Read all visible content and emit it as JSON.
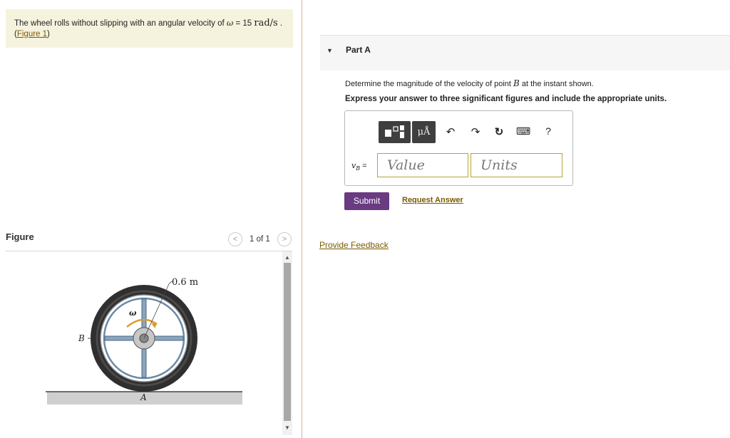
{
  "problem": {
    "text_before": "The wheel rolls without slipping with an angular velocity of ",
    "omega_symbol": "ω",
    "text_equals": " = 15 ",
    "unit": "rad/s",
    "text_after": " .",
    "figure_link": "Figure 1",
    "figure_link_open": "(",
    "figure_link_close": ")"
  },
  "figure_panel": {
    "label": "Figure",
    "prev_icon": "<",
    "next_icon": ">",
    "pager_text": "1 of 1",
    "scroll_up": "▲",
    "scroll_down": "▼",
    "diagram": {
      "dimension_label": "0.6 m",
      "omega_label": "ω",
      "point_b": "B",
      "point_a": "A"
    }
  },
  "part": {
    "caret": "▼",
    "title": "Part A",
    "question_before": "Determine the magnitude of the velocity of point ",
    "question_var": "B",
    "question_after": " at the instant shown.",
    "instruction": "Express your answer to three significant figures and include the appropriate units."
  },
  "answer": {
    "toolbar": {
      "mu_label": "μÅ",
      "undo_icon": "↶",
      "redo_icon": "↷",
      "reset_icon": "↻",
      "keyboard_icon": "⌨",
      "help_label": "?"
    },
    "var_label": "vB",
    "var_main": "v",
    "var_sub": "B",
    "equals": " =",
    "value_placeholder": "Value",
    "units_placeholder": "Units"
  },
  "actions": {
    "submit": "Submit",
    "request_answer": "Request Answer",
    "provide_feedback": "Provide Feedback"
  }
}
